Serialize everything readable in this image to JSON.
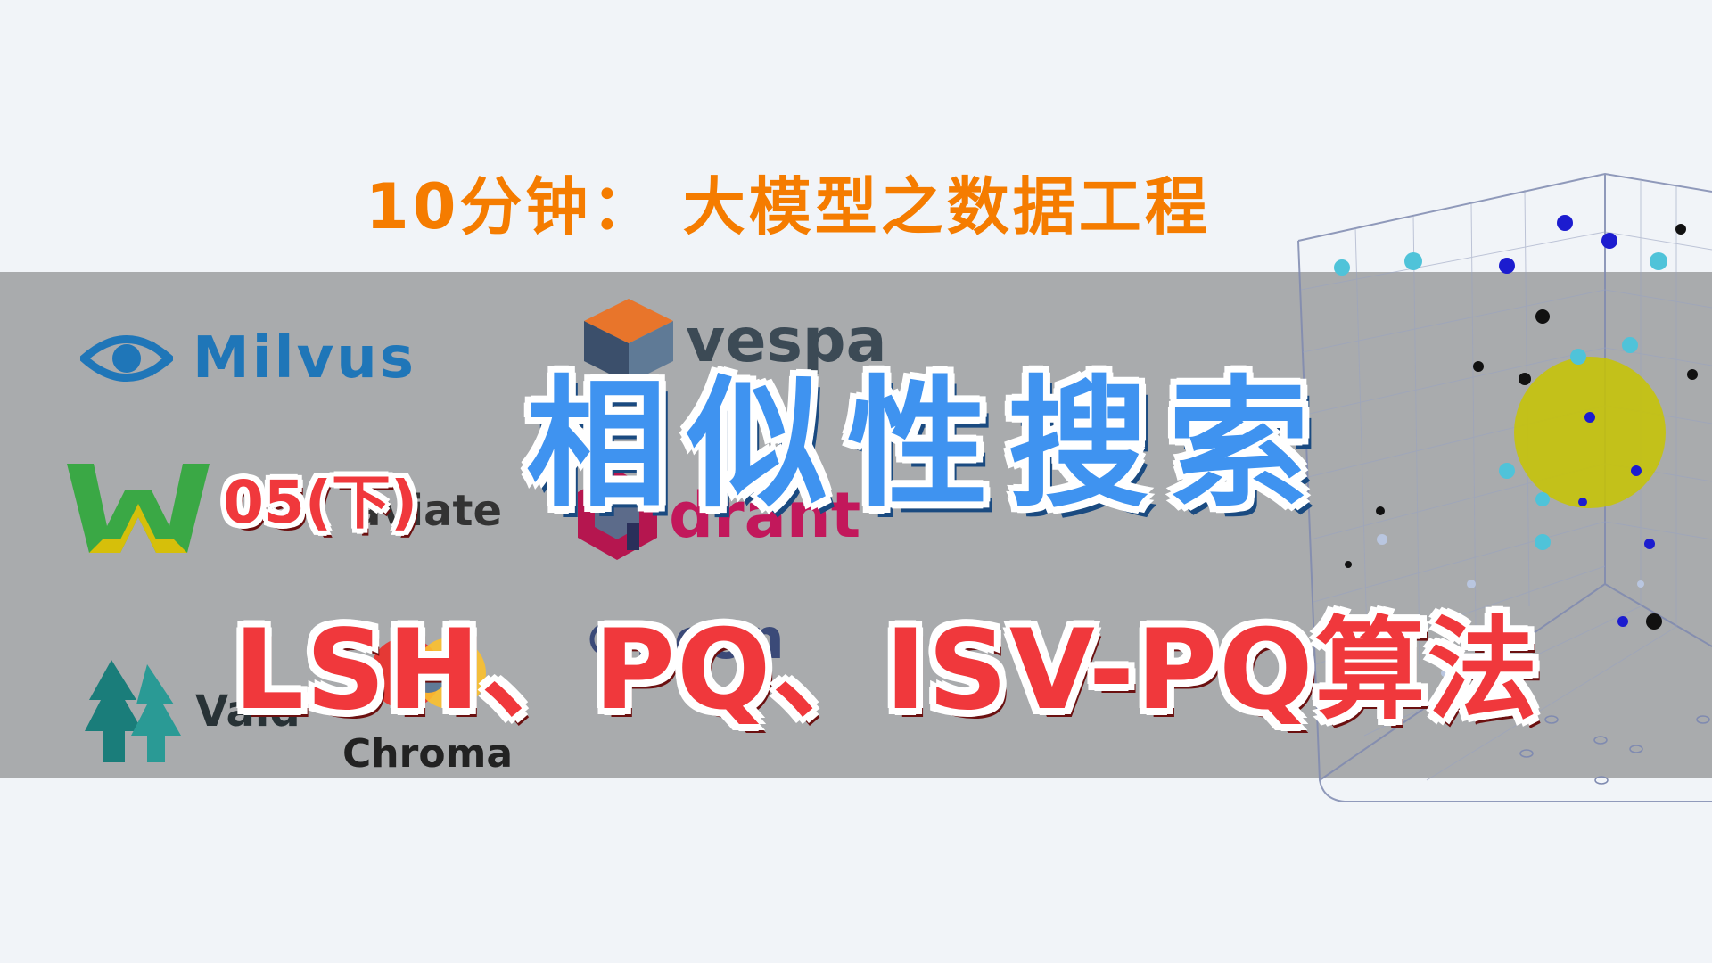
{
  "supertitle": "10分钟： 大模型之数据工程",
  "main_title": "相似性搜索",
  "episode": "05(下)",
  "subtitle": "LSH、PQ、ISV-PQ算法",
  "logos": {
    "milvus": "Milvus",
    "vespa": "vespa",
    "weaviate": "aviate",
    "qdrant": "drant",
    "pinecone": "ncon",
    "vald": "Vald",
    "chroma": "Chroma"
  },
  "colors": {
    "background": "#f1f4f8",
    "band": "#a9abad",
    "supertitle": "#f57c00",
    "main_title": "#3f93f0",
    "subtitle": "#f0383c",
    "highlight_sphere": "#c8c400"
  }
}
